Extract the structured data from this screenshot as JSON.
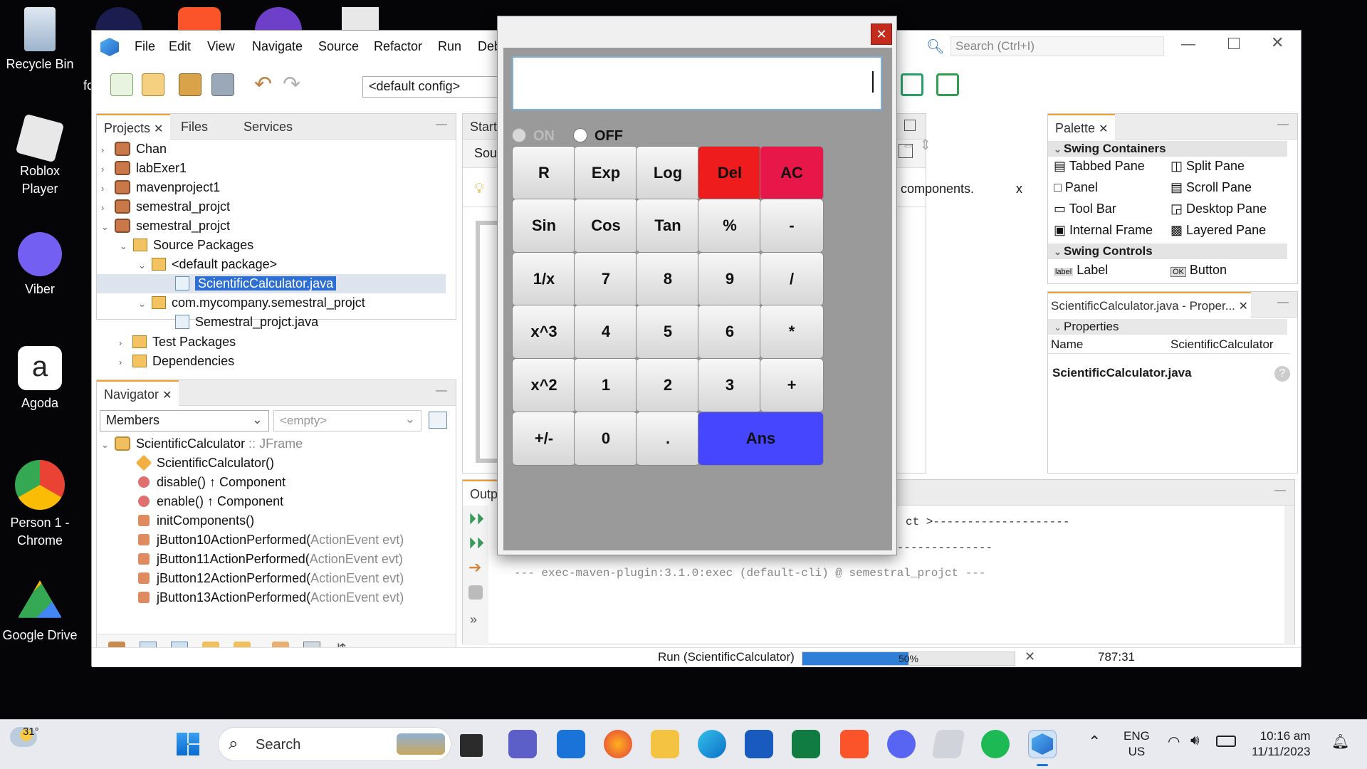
{
  "desktop": {
    "icons": [
      {
        "label": "Recycle Bin",
        "color": "#3a8fd8"
      },
      {
        "label": "Roblox Player",
        "color": "#e0e0e0"
      },
      {
        "label": "Viber",
        "color": "#7360f2"
      },
      {
        "label": "Agoda",
        "color": "#ffffff"
      },
      {
        "label": "Person 1 - Chrome",
        "color": "#4285f4"
      },
      {
        "label": "Google Drive",
        "color": "#34a853"
      }
    ],
    "partial_label": "fo"
  },
  "ide": {
    "menu": [
      "File",
      "Edit",
      "View",
      "Navigate",
      "Source",
      "Refactor",
      "Run",
      "Deb"
    ],
    "config": "<default config>",
    "search_placeholder": "Search (Ctrl+I)",
    "projects_tabs": [
      "Projects",
      "Files",
      "Services"
    ],
    "projects": [
      {
        "label": "Chan"
      },
      {
        "label": "labExer1"
      },
      {
        "label": "mavenproject1"
      },
      {
        "label": "semestral_projct"
      },
      {
        "label": "semestral_projct"
      },
      {
        "label": "Source Packages"
      },
      {
        "label": "<default package>"
      },
      {
        "label": "ScientificCalculator.java"
      },
      {
        "label": "com.mycompany.semestral_projct"
      },
      {
        "label": "Semestral_projct.java"
      },
      {
        "label": "Test Packages"
      },
      {
        "label": "Dependencies"
      }
    ],
    "navigator": {
      "title": "Navigator",
      "members": "Members",
      "empty": "<empty>",
      "items": [
        {
          "name": "ScientificCalculator",
          "suffix": " :: JFrame"
        },
        {
          "name": "ScientificCalculator()",
          "suffix": ""
        },
        {
          "name": "disable()",
          "suffix": " ↑ Component"
        },
        {
          "name": "enable()",
          "suffix": " ↑ Component"
        },
        {
          "name": "initComponents()",
          "suffix": ""
        },
        {
          "name": "jButton10ActionPerformed(",
          "suffix": "ActionEvent evt)"
        },
        {
          "name": "jButton11ActionPerformed(",
          "suffix": "ActionEvent evt)"
        },
        {
          "name": "jButton12ActionPerformed(",
          "suffix": "ActionEvent evt)"
        },
        {
          "name": "jButton13ActionPerformed(",
          "suffix": "ActionEvent evt)"
        }
      ]
    },
    "editor": {
      "tab_partial": "Start",
      "source_partial": "Sour",
      "hint_tail": "components.",
      "hint_close": "x",
      "output_partial": "Outp"
    },
    "output": {
      "line1": "ct >--------------------",
      "line2": "------------------------------[ jar ]---------------------------------",
      "line3": "--- exec-maven-plugin:3.1.0:exec (default-cli) @ semestral_projct ---"
    },
    "palette": {
      "title": "Palette",
      "groups": [
        {
          "name": "Swing Containers",
          "items": [
            "Tabbed Pane",
            "Split Pane",
            "Panel",
            "Scroll Pane",
            "Tool Bar",
            "Desktop Pane",
            "Internal Frame",
            "Layered Pane"
          ]
        },
        {
          "name": "Swing Controls",
          "items": [
            "Label",
            "Button"
          ]
        }
      ]
    },
    "properties": {
      "title": "ScientificCalculator.java - Proper...",
      "section": "Properties",
      "key": "Name",
      "value": "ScientificCalculator",
      "file": "ScientificCalculator.java"
    },
    "status": {
      "run": "Run (ScientificCalculator)",
      "progress_text": "50%",
      "progress": 0.5,
      "position": "787:31"
    }
  },
  "calculator": {
    "display_value": "",
    "radio_on": "ON",
    "radio_off": "OFF",
    "buttons": [
      [
        "R",
        "Exp",
        "Log",
        "Del",
        "AC"
      ],
      [
        "Sin",
        "Cos",
        "Tan",
        "%",
        "-"
      ],
      [
        "1/x",
        "7",
        "8",
        "9",
        "/"
      ],
      [
        "x^3",
        "4",
        "5",
        "6",
        "*"
      ],
      [
        "x^2",
        "1",
        "2",
        "3",
        "+"
      ],
      [
        "+/-",
        "0",
        ".",
        "Ans"
      ]
    ],
    "colors": {
      "del": "#ee1c1c",
      "ac": "#e8174a",
      "ans": "#4646ff"
    }
  },
  "taskbar": {
    "weather_temp": "31°",
    "search": "Search",
    "lang": "ENG",
    "region": "US",
    "time": "10:16 am",
    "date": "11/11/2023"
  }
}
